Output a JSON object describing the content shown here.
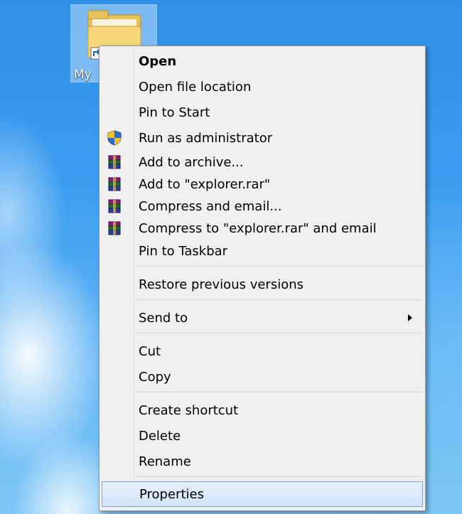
{
  "desktop": {
    "icon_label": "My"
  },
  "menu": {
    "items": [
      {
        "label": "Open"
      },
      {
        "label": "Open file location"
      },
      {
        "label": "Pin to Start"
      },
      {
        "label": "Run as administrator",
        "icon": "uac-shield-icon"
      },
      {
        "label": "Add to archive...",
        "icon": "winrar-icon"
      },
      {
        "label": "Add to \"explorer.rar\"",
        "icon": "winrar-icon"
      },
      {
        "label": "Compress and email...",
        "icon": "winrar-icon"
      },
      {
        "label": "Compress to \"explorer.rar\" and email",
        "icon": "winrar-icon"
      },
      {
        "label": "Pin to Taskbar"
      },
      {
        "label": "Restore previous versions"
      },
      {
        "label": "Send to"
      },
      {
        "label": "Cut"
      },
      {
        "label": "Copy"
      },
      {
        "label": "Create shortcut"
      },
      {
        "label": "Delete"
      },
      {
        "label": "Rename"
      },
      {
        "label": "Properties"
      }
    ]
  },
  "colors": {
    "menu_background": "#f0f0f0",
    "highlight_border": "#7da2ce",
    "highlight_fill": "#d3e5f8"
  }
}
